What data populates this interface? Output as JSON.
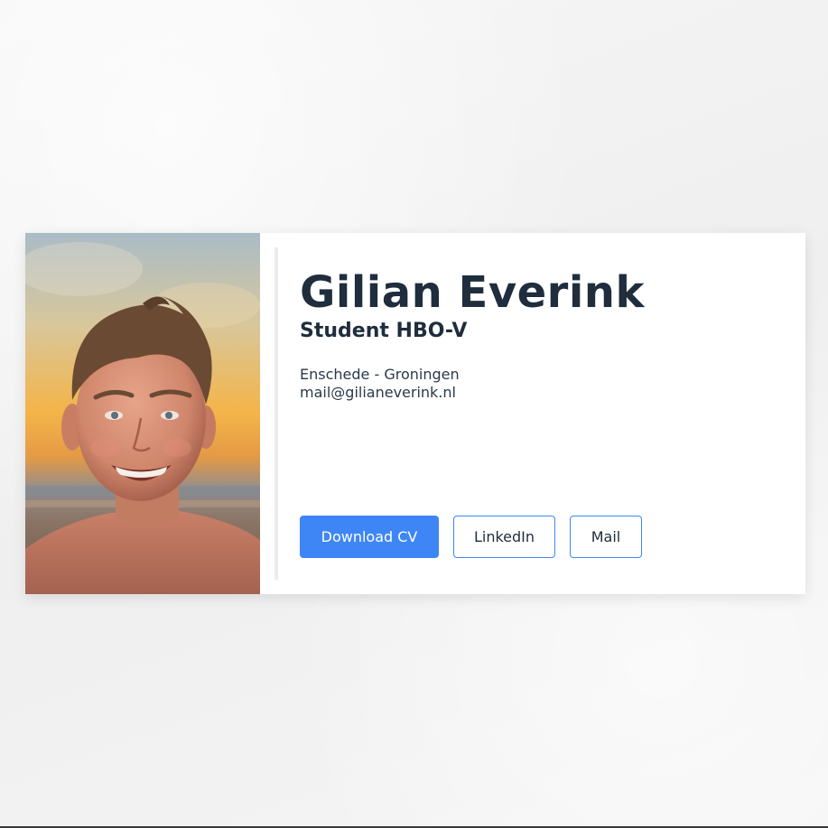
{
  "profile": {
    "name": "Gilian Everink",
    "role": "Student HBO-V",
    "location": "Enschede - Groningen",
    "email": "mail@gilianeverink.nl"
  },
  "buttons": {
    "download_cv": "Download CV",
    "linkedin": "LinkedIn",
    "mail": "Mail"
  },
  "colors": {
    "accent": "#3e86f5",
    "heading": "#1f2d3d",
    "page_background": "#f3f3f3",
    "card_background": "#ffffff"
  }
}
